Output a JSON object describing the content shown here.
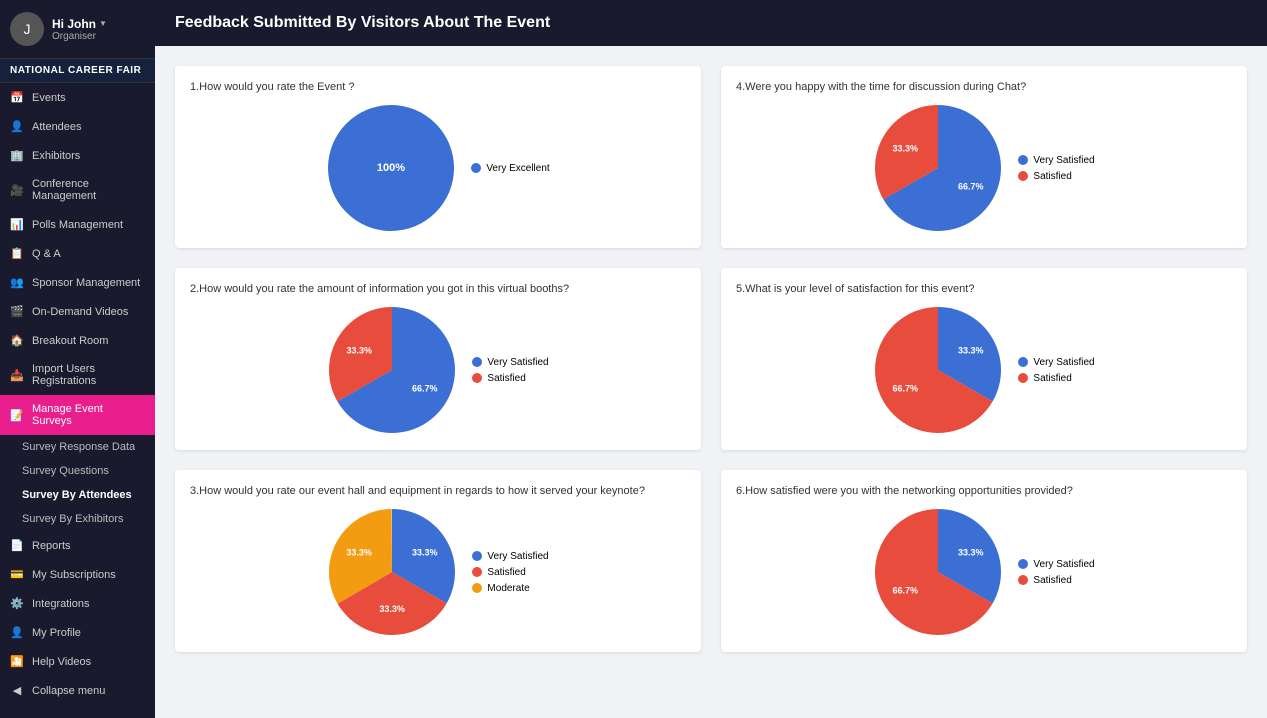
{
  "user": {
    "name": "Hi John",
    "role": "Organiser",
    "avatar_initial": "J"
  },
  "org": {
    "label": "NATIONAL CAREER FAIR"
  },
  "header": {
    "title": "Feedback Submitted By Visitors About The Event"
  },
  "nav": {
    "items": [
      {
        "id": "events",
        "label": "Events",
        "icon": "📅"
      },
      {
        "id": "attendees",
        "label": "Attendees",
        "icon": "👤"
      },
      {
        "id": "exhibitors",
        "label": "Exhibitors",
        "icon": "🏢"
      },
      {
        "id": "conference",
        "label": "Conference Management",
        "icon": "🎥"
      },
      {
        "id": "polls",
        "label": "Polls Management",
        "icon": "📊"
      },
      {
        "id": "qa",
        "label": "Q & A",
        "icon": "📋"
      },
      {
        "id": "sponsor",
        "label": "Sponsor Management",
        "icon": "👥"
      },
      {
        "id": "ondemand",
        "label": "On-Demand Videos",
        "icon": "🎬"
      },
      {
        "id": "breakout",
        "label": "Breakout Room",
        "icon": "🏠"
      },
      {
        "id": "import",
        "label": "Import Users Registrations",
        "icon": "📥"
      },
      {
        "id": "surveys",
        "label": "Manage Event Surveys",
        "icon": "📝",
        "active": true
      }
    ],
    "sub_items": [
      {
        "id": "response",
        "label": "Survey Response Data"
      },
      {
        "id": "questions",
        "label": "Survey Questions"
      },
      {
        "id": "by_attendees",
        "label": "Survey By Attendees",
        "active": true
      },
      {
        "id": "by_exhibitors",
        "label": "Survey By Exhibitors"
      }
    ],
    "bottom_items": [
      {
        "id": "reports",
        "label": "Reports",
        "icon": "📄"
      },
      {
        "id": "subscriptions",
        "label": "My Subscriptions",
        "icon": "💳"
      },
      {
        "id": "integrations",
        "label": "Integrations",
        "icon": "⚙️"
      },
      {
        "id": "profile",
        "label": "My Profile",
        "icon": "👤"
      },
      {
        "id": "help",
        "label": "Help Videos",
        "icon": "🎦"
      },
      {
        "id": "collapse",
        "label": "Collapse menu",
        "icon": "◀"
      }
    ]
  },
  "charts": [
    {
      "id": "q1",
      "question": "1.How would you rate the Event ?",
      "slices": [
        {
          "label": "Very Excellent",
          "value": 100,
          "color": "#3b6fd4",
          "percent": "100%"
        }
      ]
    },
    {
      "id": "q4",
      "question": "4.Were you happy with the time for discussion during Chat?",
      "slices": [
        {
          "label": "Very Satisfied",
          "value": 66.7,
          "color": "#3b6fd4",
          "percent": "66.7%"
        },
        {
          "label": "Satisfied",
          "value": 33.3,
          "color": "#e74c3c",
          "percent": "33.3%"
        }
      ]
    },
    {
      "id": "q2",
      "question": "2.How would you rate the amount of information you got in this virtual booths?",
      "slices": [
        {
          "label": "Very Satisfied",
          "value": 66.7,
          "color": "#3b6fd4",
          "percent": "66.7%"
        },
        {
          "label": "Satisfied",
          "value": 33.3,
          "color": "#e74c3c",
          "percent": "33.3%"
        }
      ]
    },
    {
      "id": "q5",
      "question": "5.What is your level of satisfaction for this event?",
      "slices": [
        {
          "label": "Very Satisfied",
          "value": 33.3,
          "color": "#3b6fd4",
          "percent": "33.3%"
        },
        {
          "label": "Satisfied",
          "value": 66.7,
          "color": "#e74c3c",
          "percent": "66.7%"
        }
      ]
    },
    {
      "id": "q3",
      "question": "3.How would you rate our event hall and equipment in regards to how it served your keynote?",
      "slices": [
        {
          "label": "Very Satisfied",
          "value": 33.3,
          "color": "#3b6fd4",
          "percent": "33.3%"
        },
        {
          "label": "Satisfied",
          "value": 33.3,
          "color": "#e74c3c",
          "percent": "33.3%"
        },
        {
          "label": "Moderate",
          "value": 33.3,
          "color": "#f39c12",
          "percent": "33.3%"
        }
      ]
    },
    {
      "id": "q6",
      "question": "6.How satisfied were you with the networking opportunities provided?",
      "slices": [
        {
          "label": "Very Satisfied",
          "value": 33.3,
          "color": "#3b6fd4",
          "percent": "33.3%"
        },
        {
          "label": "Satisfied",
          "value": 66.7,
          "color": "#e74c3c",
          "percent": "66.7%"
        }
      ]
    }
  ]
}
